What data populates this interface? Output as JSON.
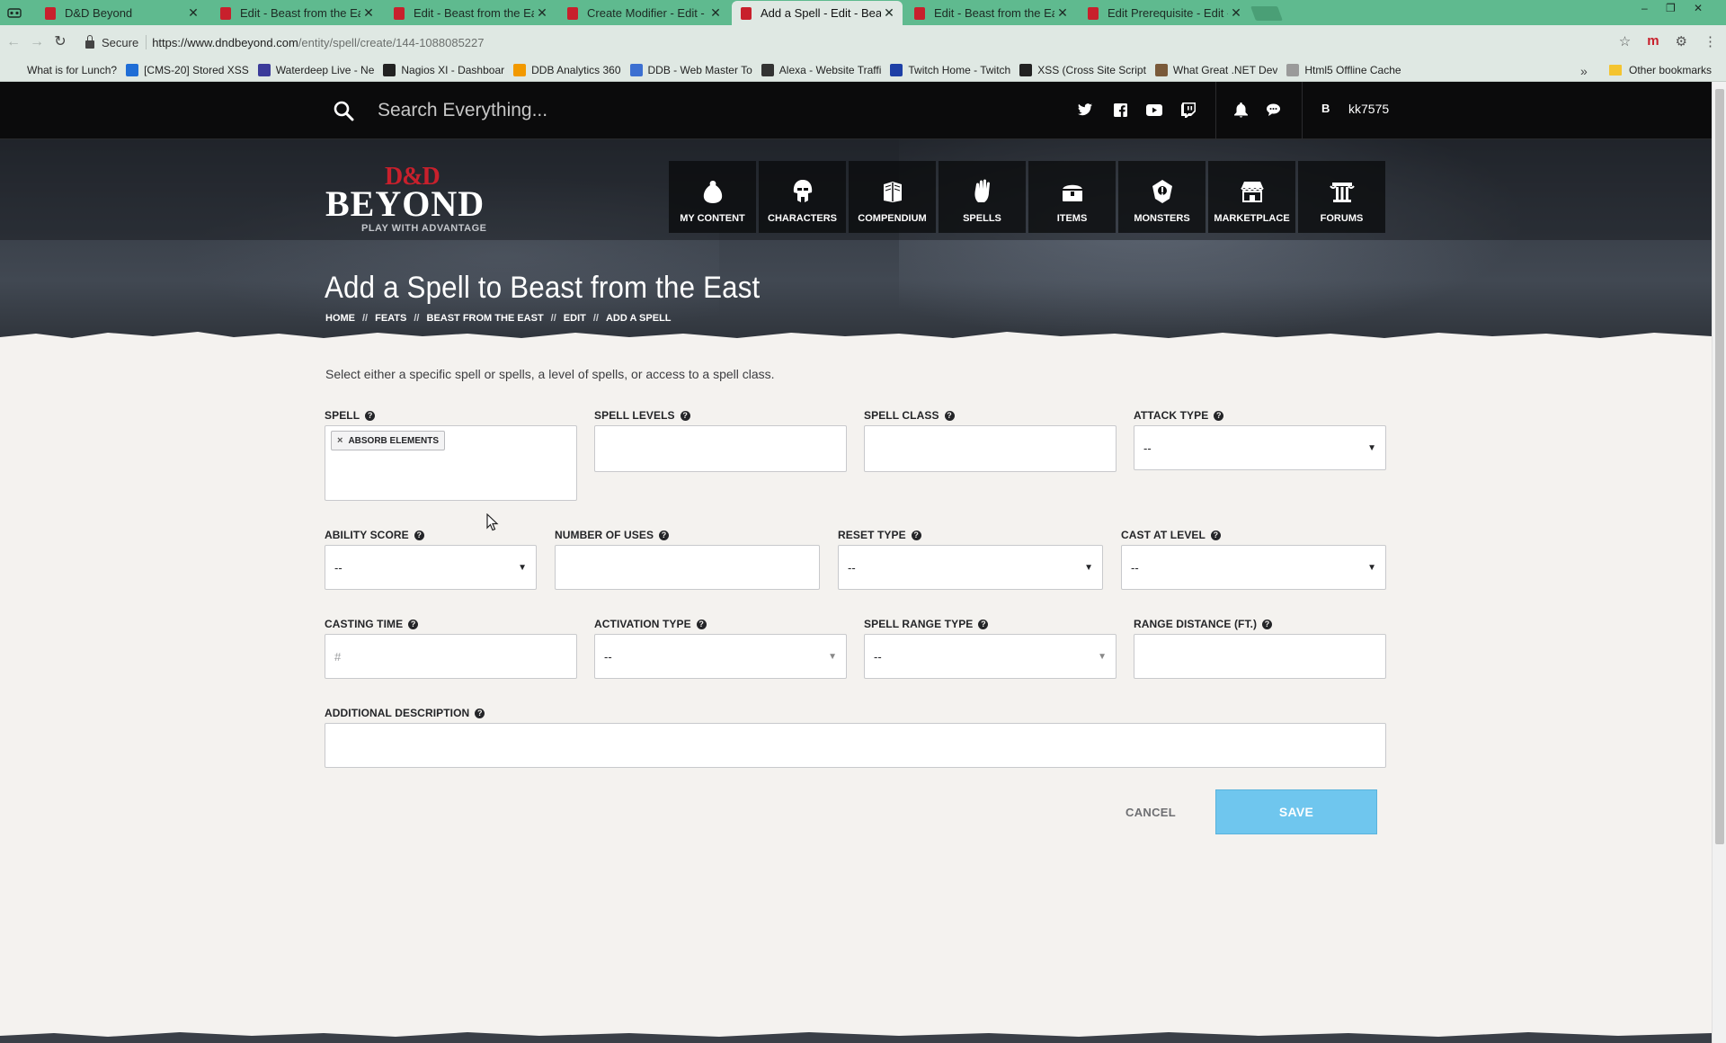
{
  "browser": {
    "tabs": [
      {
        "title": "D&D Beyond",
        "active": false
      },
      {
        "title": "Edit - Beast from the East",
        "active": false
      },
      {
        "title": "Edit - Beast from the East",
        "active": false
      },
      {
        "title": "Create Modifier - Edit - B",
        "active": false
      },
      {
        "title": "Add a Spell - Edit - Beast",
        "active": true
      },
      {
        "title": "Edit - Beast from the East",
        "active": false
      },
      {
        "title": "Edit Prerequisite - Edit - B",
        "active": false
      }
    ],
    "secure_label": "Secure",
    "url_host": "https://www.dndbeyond.com",
    "url_path": "/entity/spell/create/144-1088085227",
    "bookmarks": [
      {
        "label": "What is for Lunch?",
        "icon": "page-icon",
        "color": "#dfe8e3"
      },
      {
        "label": "[CMS-20] Stored XSS",
        "icon": "jira-icon",
        "color": "#1f6dd6"
      },
      {
        "label": "Waterdeep Live - Ne",
        "icon": "dragon-icon",
        "color": "#3b3b9a"
      },
      {
        "label": "Nagios XI - Dashboar",
        "icon": "nagios-icon",
        "color": "#222222"
      },
      {
        "label": "DDB Analytics 360",
        "icon": "analytics-icon",
        "color": "#f29900"
      },
      {
        "label": "DDB - Web Master To",
        "icon": "webmaster-icon",
        "color": "#3c6fd1"
      },
      {
        "label": "Alexa - Website Traffi",
        "icon": "alexa-icon",
        "color": "#333333"
      },
      {
        "label": "Twitch Home - Twitch",
        "icon": "twitch-x-icon",
        "color": "#1d3fa6"
      },
      {
        "label": "XSS (Cross Site Script",
        "icon": "rs-icon",
        "color": "#222222"
      },
      {
        "label": "What Great .NET Dev",
        "icon": "person-icon",
        "color": "#7a5a3a"
      },
      {
        "label": "Html5 Offline Cache",
        "icon": "page-icon",
        "color": "#9a9a9a"
      }
    ],
    "more_label": "»",
    "other_bookmarks": "Other bookmarks"
  },
  "site": {
    "search_placeholder": "Search Everything...",
    "username": "kk7575",
    "logo_top": "D&D",
    "logo_main": "BEYOND",
    "logo_tagline": "PLAY WITH ADVANTAGE",
    "nav": [
      {
        "label": "MY CONTENT",
        "icon": "bag-icon"
      },
      {
        "label": "CHARACTERS",
        "icon": "helmet-icon"
      },
      {
        "label": "COMPENDIUM",
        "icon": "book-icon"
      },
      {
        "label": "SPELLS",
        "icon": "hand-icon"
      },
      {
        "label": "ITEMS",
        "icon": "chest-icon"
      },
      {
        "label": "MONSTERS",
        "icon": "monster-icon"
      },
      {
        "label": "MARKETPLACE",
        "icon": "store-icon"
      },
      {
        "label": "FORUMS",
        "icon": "pillar-icon"
      }
    ],
    "accent": "#c8202c"
  },
  "page": {
    "title": "Add a Spell to Beast from the East",
    "breadcrumb": [
      "HOME",
      "FEATS",
      "BEAST FROM THE EAST",
      "EDIT",
      "ADD A SPELL"
    ],
    "breadcrumb_sep": "//",
    "intro": "Select either a specific spell or spells, a level of spells, or access to a spell class."
  },
  "form": {
    "spell": {
      "label": "SPELL",
      "chip": "ABSORB ELEMENTS"
    },
    "spell_levels": {
      "label": "SPELL LEVELS",
      "value": ""
    },
    "spell_class": {
      "label": "SPELL CLASS",
      "value": ""
    },
    "attack_type": {
      "label": "ATTACK TYPE",
      "value": "--"
    },
    "ability_score": {
      "label": "ABILITY SCORE",
      "value": "--"
    },
    "number_of_uses": {
      "label": "NUMBER OF USES",
      "value": ""
    },
    "reset_type": {
      "label": "RESET TYPE",
      "value": "--"
    },
    "cast_at_level": {
      "label": "CAST AT LEVEL",
      "value": "--"
    },
    "casting_time": {
      "label": "CASTING TIME",
      "placeholder": "#"
    },
    "activation_type": {
      "label": "ACTIVATION TYPE",
      "value": "--"
    },
    "spell_range_type": {
      "label": "SPELL RANGE TYPE",
      "value": "--"
    },
    "range_distance": {
      "label": "RANGE DISTANCE (FT.)",
      "value": ""
    },
    "additional_description": {
      "label": "ADDITIONAL DESCRIPTION",
      "value": ""
    },
    "help_glyph": "?",
    "chip_remove": "×",
    "cancel_label": "CANCEL",
    "save_label": "SAVE",
    "save_color": "#6fc6ee"
  }
}
